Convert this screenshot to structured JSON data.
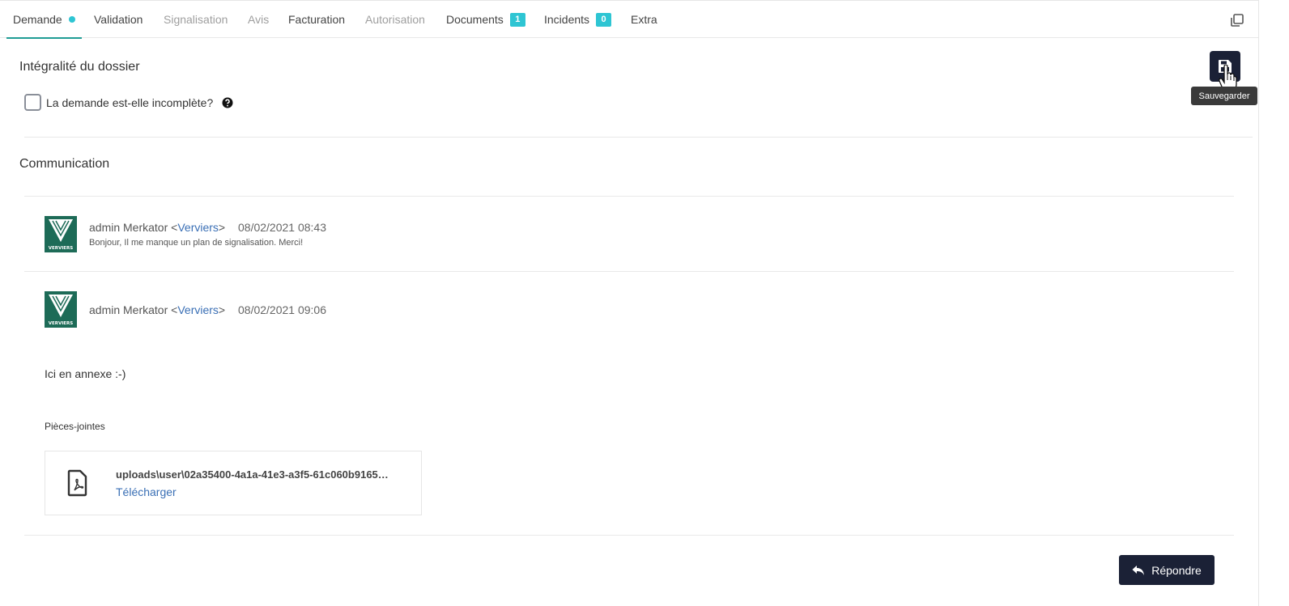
{
  "tabs": [
    {
      "label": "Demande",
      "state": "active",
      "dot": true
    },
    {
      "label": "Validation",
      "state": "normal"
    },
    {
      "label": "Signalisation",
      "state": "disabled"
    },
    {
      "label": "Avis",
      "state": "disabled"
    },
    {
      "label": "Facturation",
      "state": "normal"
    },
    {
      "label": "Autorisation",
      "state": "disabled"
    },
    {
      "label": "Documents",
      "state": "normal",
      "badge": "1"
    },
    {
      "label": "Incidents",
      "state": "normal",
      "badge": "0"
    },
    {
      "label": "Extra",
      "state": "normal"
    }
  ],
  "toolbar": {
    "save_tooltip": "Sauvegarder",
    "save_icon": "floppy-disk-icon",
    "window_icon": "window-restore-icon"
  },
  "dossier": {
    "title": "Intégralité du dossier",
    "checkbox_label": "La demande est-elle incomplète?",
    "checked": false
  },
  "communication": {
    "title": "Communication",
    "messages": [
      {
        "author": "admin Merkator",
        "org": "Verviers",
        "date": "08/02/2021 08:43",
        "body": "Bonjour, Il me manque un plan de signalisation. Merci!",
        "avatar_caption": "VERVIERS"
      },
      {
        "author": "admin Merkator",
        "org": "Verviers",
        "date": "08/02/2021 09:06",
        "body": "Ici en annexe :-)",
        "avatar_caption": "VERVIERS",
        "attachments_title": "Pièces-jointes",
        "attachments": [
          {
            "name": "uploads\\user\\02a35400-4a1a-41e3-a3f5-61c060b9165…",
            "download_label": "Télécharger",
            "icon": "pdf-file-icon"
          }
        ]
      }
    ]
  },
  "reply": {
    "label": "Répondre",
    "icon": "reply-icon"
  },
  "colors": {
    "accent": "#2ec5d3",
    "primary_dark": "#1b2136",
    "link": "#3a6fb5",
    "avatar_bg": "#1d6b57"
  }
}
